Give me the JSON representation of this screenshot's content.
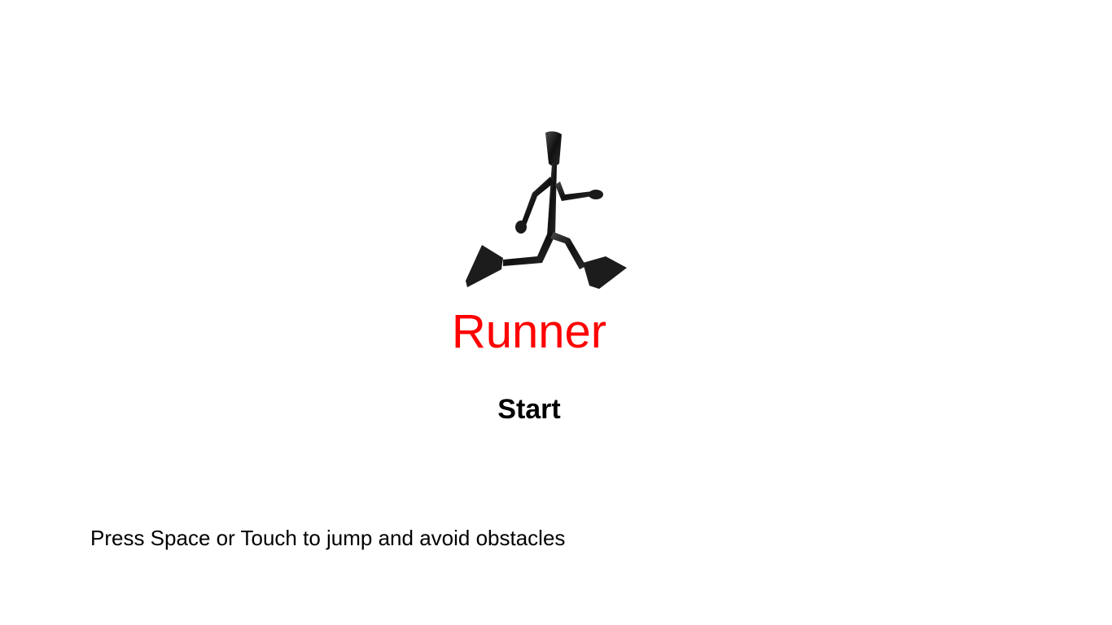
{
  "game": {
    "title": "Runner",
    "title_color": "#ff0000",
    "start_label": "Start",
    "instructions": "Press Space or Touch to jump and avoid obstacles"
  },
  "icons": {
    "runner": "running-stick-figure-icon"
  }
}
